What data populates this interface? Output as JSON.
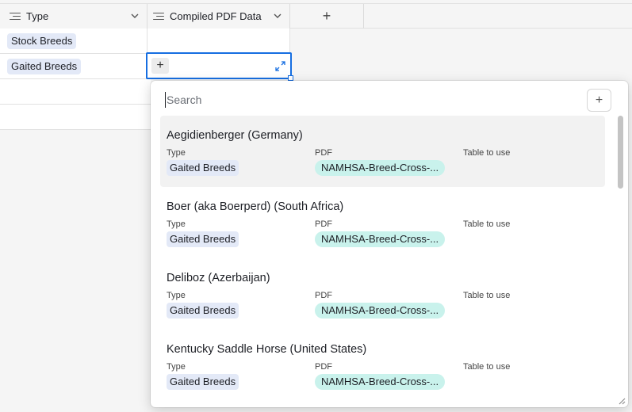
{
  "columns": [
    {
      "label": "Type"
    },
    {
      "label": "Compiled PDF Data"
    }
  ],
  "add_column_label": "+",
  "rows": [
    {
      "type": "Stock Breeds"
    },
    {
      "type": "Gaited Breeds"
    }
  ],
  "active_cell": {
    "plus_label": "+"
  },
  "popup": {
    "search_placeholder": "Search",
    "new_label": "+",
    "field_labels": {
      "type": "Type",
      "pdf": "PDF",
      "table": "Table to use"
    },
    "records": [
      {
        "title": "Aegidienberger (Germany)",
        "type": "Gaited Breeds",
        "pdf": "NAMHSA-Breed-Cross-..."
      },
      {
        "title": "Boer (aka Boerperd) (South Africa)",
        "type": "Gaited Breeds",
        "pdf": "NAMHSA-Breed-Cross-..."
      },
      {
        "title": "Deliboz (Azerbaijan)",
        "type": "Gaited Breeds",
        "pdf": "NAMHSA-Breed-Cross-..."
      },
      {
        "title": "Kentucky Saddle Horse (United States)",
        "type": "Gaited Breeds",
        "pdf": "NAMHSA-Breed-Cross-..."
      }
    ]
  },
  "colors": {
    "accent": "#166ee1",
    "type_pill": "#e3e9f7",
    "pdf_pill": "#c9f2ec"
  },
  "icons": [
    "field-type-icon",
    "chevron-down-icon",
    "plus-icon",
    "expand-icon",
    "resize-handle-icon"
  ]
}
